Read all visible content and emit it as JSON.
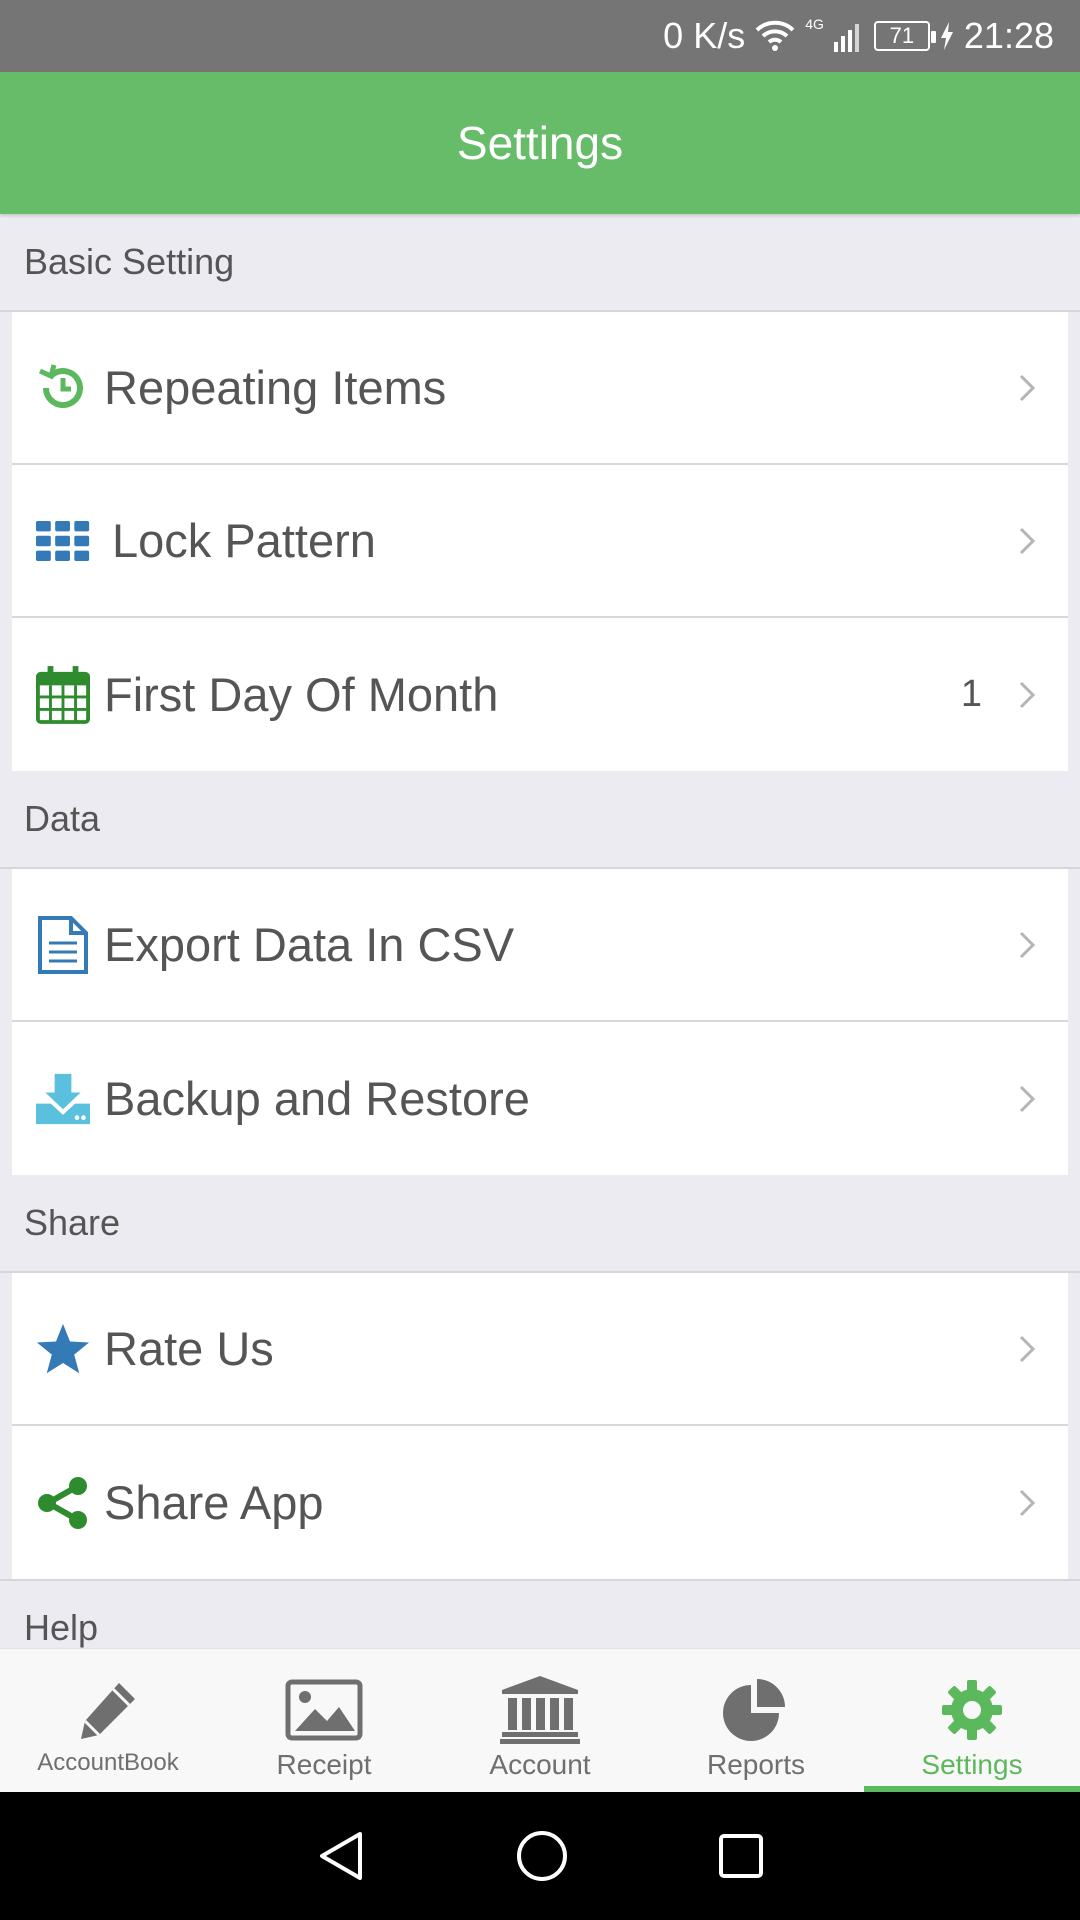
{
  "status_bar": {
    "net_speed": "0 K/s",
    "network_type": "4G",
    "battery": "71",
    "time": "21:28"
  },
  "app_bar": {
    "title": "Settings"
  },
  "sections": {
    "basic": {
      "header": "Basic Setting",
      "items": [
        {
          "label": "Repeating Items",
          "icon": "repeat-clock-icon",
          "color": "#5cb85c"
        },
        {
          "label": "Lock Pattern",
          "icon": "grid-icon",
          "color": "#337ab7"
        },
        {
          "label": "First Day Of Month",
          "value": "1",
          "icon": "calendar-icon",
          "color": "#2e8b2e"
        }
      ]
    },
    "data": {
      "header": "Data",
      "items": [
        {
          "label": "Export Data In CSV",
          "icon": "document-icon",
          "color": "#337ab7"
        },
        {
          "label": "Backup and Restore",
          "icon": "download-icon",
          "color": "#5bc0de"
        }
      ]
    },
    "share": {
      "header": "Share",
      "items": [
        {
          "label": "Rate Us",
          "icon": "star-icon",
          "color": "#337ab7"
        },
        {
          "label": "Share App",
          "icon": "share-icon",
          "color": "#2e8b2e"
        }
      ]
    },
    "help": {
      "header": "Help"
    }
  },
  "tabs": [
    {
      "label": "AccountBook",
      "icon": "pencil-icon"
    },
    {
      "label": "Receipt",
      "icon": "image-icon"
    },
    {
      "label": "Account",
      "icon": "bank-icon"
    },
    {
      "label": "Reports",
      "icon": "pie-chart-icon"
    },
    {
      "label": "Settings",
      "icon": "gear-icon",
      "active": true
    }
  ],
  "colors": {
    "accent": "#67bc6a",
    "active_tab": "#5cb85c",
    "status_bar": "#757575",
    "background": "#ebebf1"
  }
}
